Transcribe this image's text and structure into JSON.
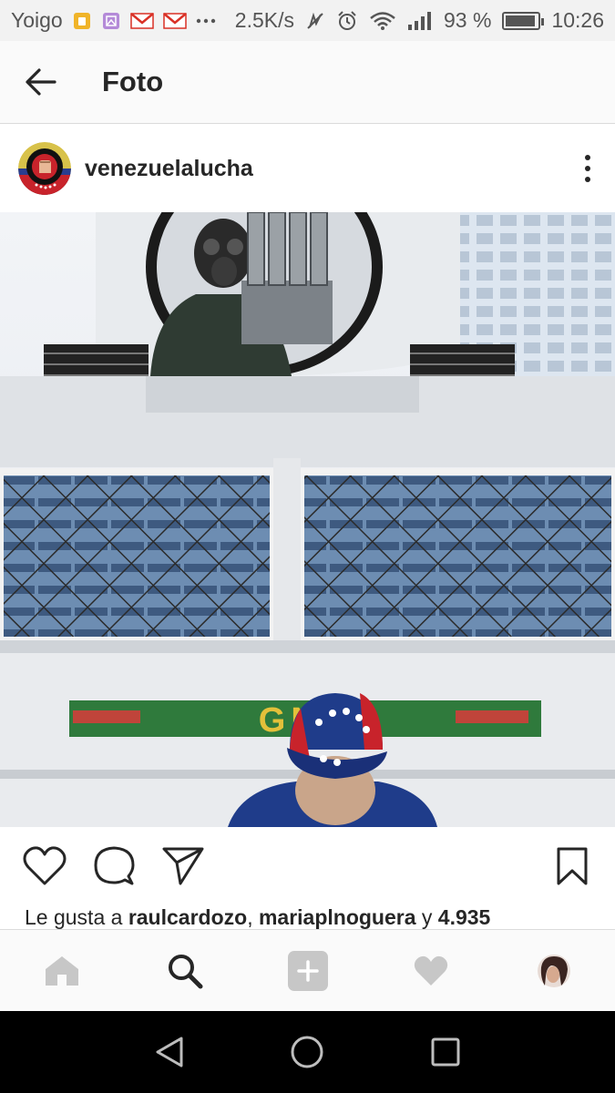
{
  "status_bar": {
    "carrier": "Yoigo",
    "network_speed": "2.5K/s",
    "battery_percent": "93 %",
    "battery_level": 0.93,
    "time": "10:26",
    "notification_icons": [
      "sim-card-icon",
      "gallery-icon",
      "gmail-icon",
      "gmail-icon",
      "more-notifications-icon"
    ]
  },
  "header": {
    "title": "Foto"
  },
  "post": {
    "username": "venezuelalucha",
    "photo_text": "GNB",
    "likes_prefix": "Le gusta a ",
    "likes_user_1": "raulcardozo",
    "likes_separator": ", ",
    "likes_user_2": "mariaplnoguera",
    "likes_and": " y ",
    "likes_count": "4.935"
  },
  "colors": {
    "accent": "#262626",
    "nav_inactive": "#c7c7c7",
    "status_bg": "#f2f2f2",
    "header_bg": "#fafafa"
  }
}
